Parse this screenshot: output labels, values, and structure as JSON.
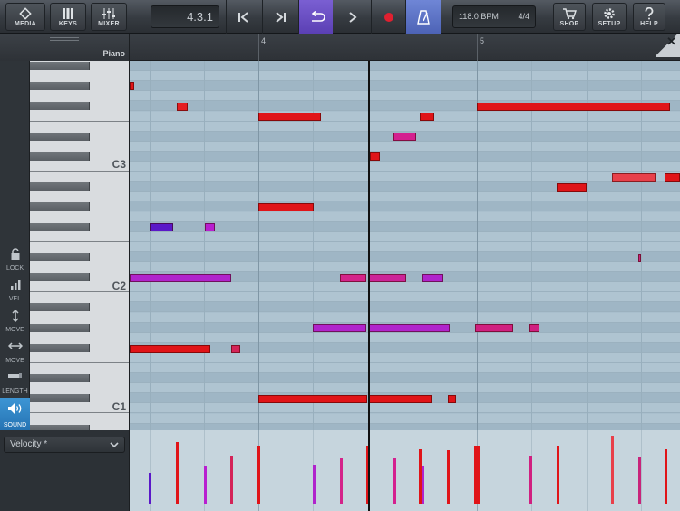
{
  "toolbar": {
    "media_label": "MEDIA",
    "keys_label": "KEYS",
    "mixer_label": "MIXER",
    "position": "4.3.1",
    "tempo": "118.0 BPM",
    "time_signature": "4/4",
    "shop_label": "SHOP",
    "setup_label": "SETUP",
    "help_label": "HELP"
  },
  "track": {
    "name": "Piano"
  },
  "ruler": {
    "bars": [
      "4",
      "5"
    ]
  },
  "keyboard": {
    "labels": [
      "C3",
      "C2",
      "C1"
    ]
  },
  "tools": [
    {
      "label": "LOCK",
      "icon": "lock-icon"
    },
    {
      "label": "VEL",
      "icon": "velocity-icon"
    },
    {
      "label": "MOVE",
      "icon": "move-vertical-icon"
    },
    {
      "label": "MOVE",
      "icon": "move-horizontal-icon"
    },
    {
      "label": "LENGTH",
      "icon": "length-icon"
    },
    {
      "label": "SOUND",
      "icon": "speaker-icon",
      "active": true
    }
  ],
  "controller": {
    "selected": "Velocity *"
  },
  "colors": {
    "loop_active": "#6a50c6",
    "metronome_active": "#5e76cc",
    "record": "#e02030",
    "tool_active": "#2f86c8",
    "grid": "#a9bfcd"
  }
}
